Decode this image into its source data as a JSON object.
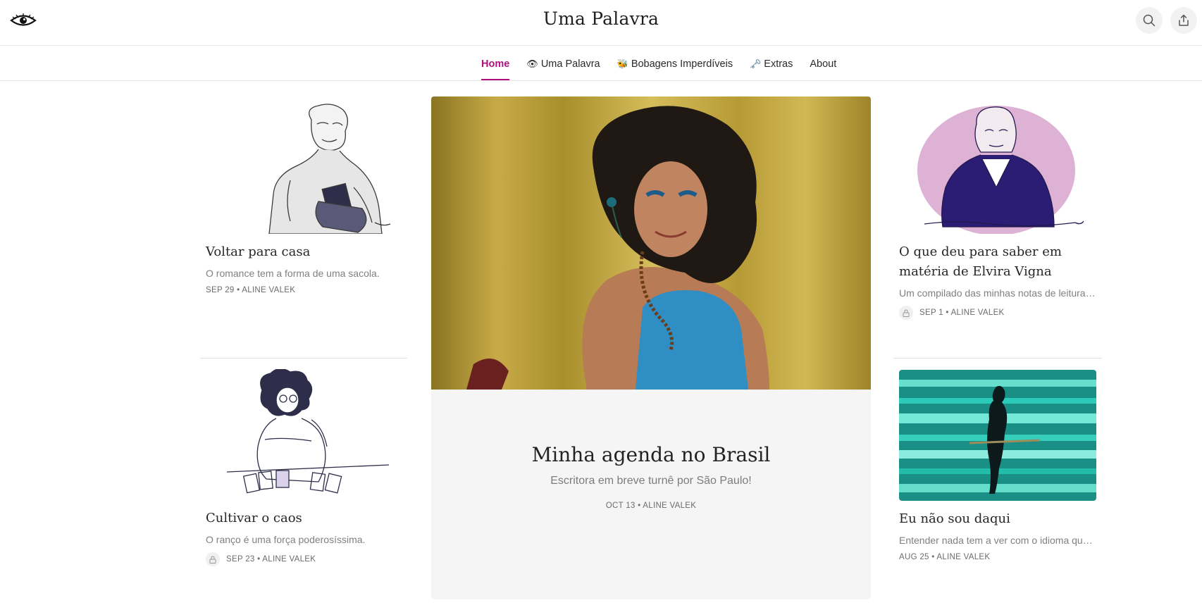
{
  "header": {
    "site_title": "Uma Palavra",
    "logo_icon": "eye-logo-icon",
    "search_icon": "search-icon",
    "share_icon": "share-icon"
  },
  "nav": {
    "items": [
      {
        "label": "Home",
        "emoji": "",
        "active": true
      },
      {
        "label": "Uma Palavra",
        "emoji": "👁",
        "active": false
      },
      {
        "label": "Bobagens Imperdíveis",
        "emoji": "🐝",
        "active": false
      },
      {
        "label": "Extras",
        "emoji": "🗝️",
        "active": false
      },
      {
        "label": "About",
        "emoji": "",
        "active": false
      }
    ],
    "accent_color": "#b0107f"
  },
  "featured": {
    "title": "Minha agenda no Brasil",
    "subtitle": "Escritora em breve turnê por São Paulo!",
    "meta": "OCT 13 • ALINE VALEK"
  },
  "left_posts": [
    {
      "title": "Voltar para casa",
      "subtitle": "O romance tem a forma de uma sacola.",
      "meta": "SEP 29 • ALINE VALEK",
      "locked": false
    },
    {
      "title": "Cultivar o caos",
      "subtitle": "O ranço é uma força poderosíssima.",
      "meta": "SEP 23 • ALINE VALEK",
      "locked": true
    }
  ],
  "right_posts": [
    {
      "title": "O que deu para saber em matéria de Elvira Vigna",
      "subtitle": "Um compilado das minhas notas de leitura e…",
      "meta": "SEP 1 • ALINE VALEK",
      "locked": true
    },
    {
      "title": "Eu não sou daqui",
      "subtitle": "Entender nada tem a ver com o idioma que s…",
      "meta": "AUG 25 • ALINE VALEK",
      "locked": false
    }
  ]
}
